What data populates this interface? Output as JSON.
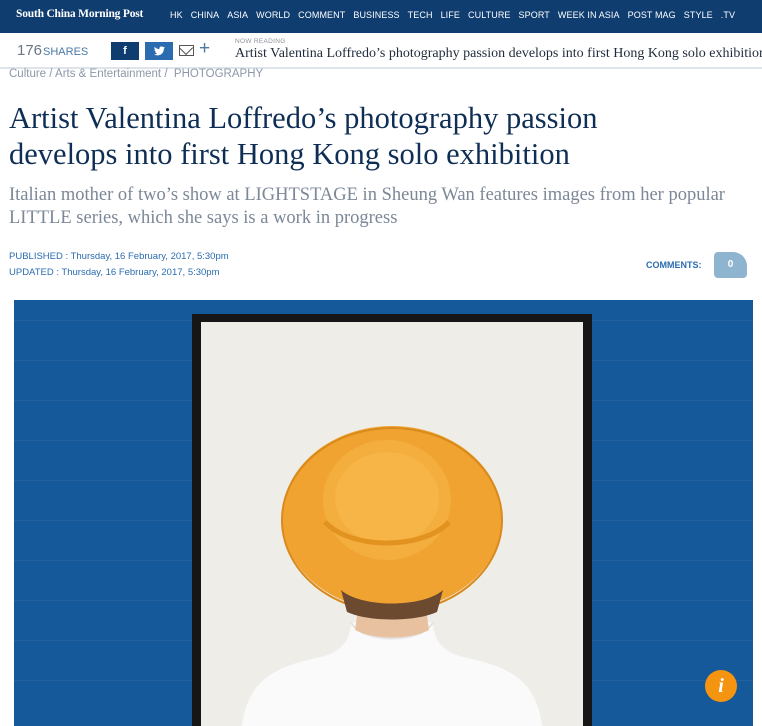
{
  "header": {
    "logo": "South China Morning Post",
    "nav": [
      "HK",
      "CHINA",
      "ASIA",
      "WORLD",
      "COMMENT",
      "BUSINESS",
      "TECH",
      "LIFE",
      "CULTURE",
      "SPORT",
      "WEEK IN ASIA",
      "POST MAG",
      "STYLE",
      ".TV"
    ]
  },
  "sharebar": {
    "count": "176",
    "count_label": "SHARES",
    "facebook": "f",
    "twitter": "t",
    "now_reading_label": "NOW READING",
    "now_reading_title": "Artist Valentina Loffredo’s photography passion develops into first Hong Kong solo exhibition"
  },
  "breadcrumb": {
    "item1": "Culture",
    "item2": "Arts & Entertainment",
    "item3": "PHOTOGRAPHY"
  },
  "article": {
    "headline": "Artist Valentina Loffredo’s photography passion develops into first Hong Kong solo exhibition",
    "subhead": "Italian mother of two’s show at LIGHTSTAGE in Sheung Wan features images from her popular LITTLE series, which she says is a work in progress",
    "published": "PUBLISHED : Thursday, 16 February, 2017, 5:30pm",
    "updated": "UPDATED : Thursday, 16 February, 2017, 5:30pm",
    "comments_label": "COMMENTS:",
    "comments_count": "0"
  },
  "hero": {
    "info_icon": "info-icon"
  }
}
